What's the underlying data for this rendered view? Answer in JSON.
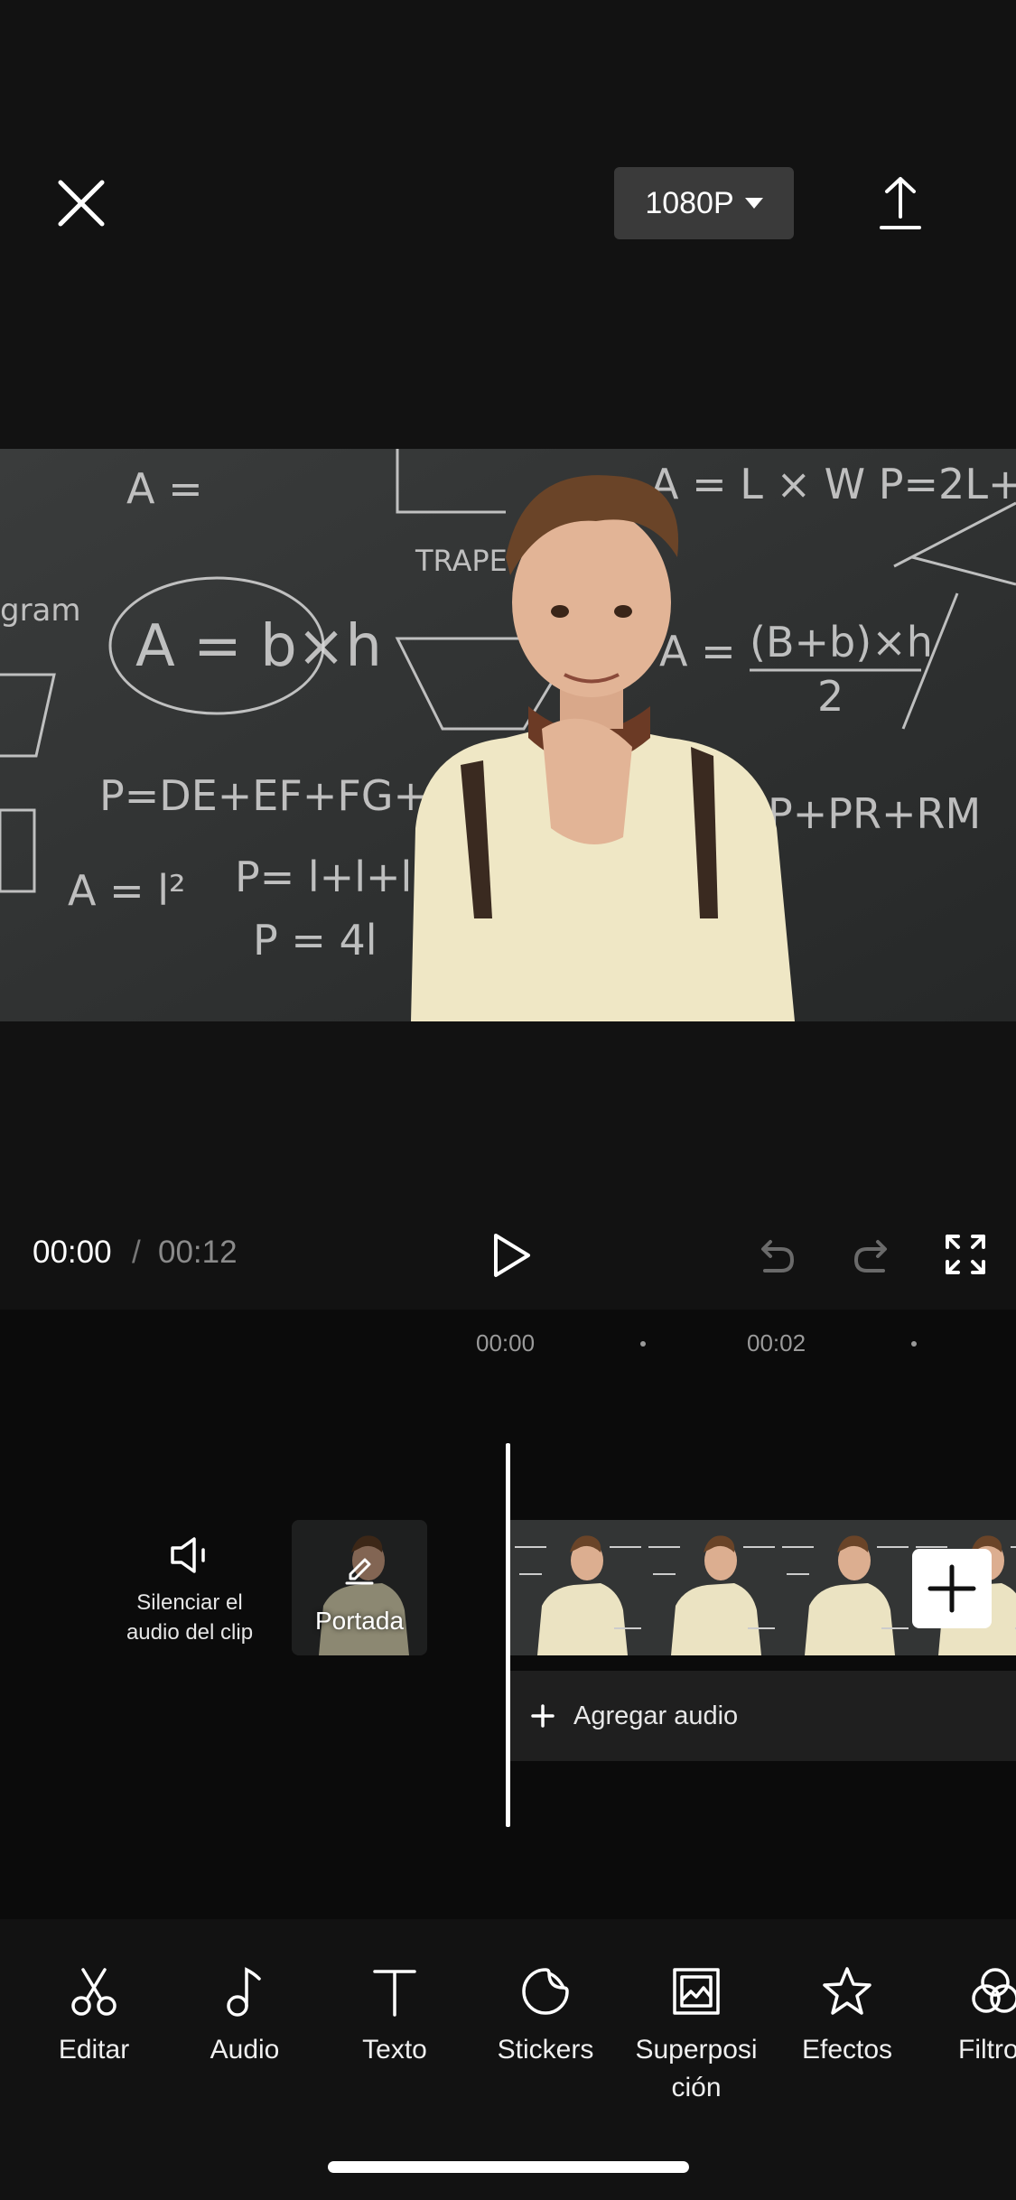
{
  "header": {
    "resolution": "1080P",
    "close_icon": "close-icon",
    "export_icon": "upload-icon"
  },
  "playback": {
    "current_time": "00:00",
    "separator": "/",
    "total_time": "00:12"
  },
  "timeline": {
    "ruler": [
      "00:00",
      "00:02"
    ],
    "mute_label_line1": "Silenciar el",
    "mute_label_line2": "audio del clip",
    "cover_label": "Portada",
    "add_audio_label": "Agregar audio"
  },
  "toolbar": {
    "items": [
      {
        "label": "Editar",
        "icon": "scissors-icon"
      },
      {
        "label": "Audio",
        "icon": "music-note-icon"
      },
      {
        "label": "Texto",
        "icon": "text-icon"
      },
      {
        "label": "Stickers",
        "icon": "sticker-icon"
      },
      {
        "label": "Superposi\nción",
        "icon": "overlay-icon"
      },
      {
        "label": "Efectos",
        "icon": "star-icon"
      },
      {
        "label": "Filtro",
        "icon": "filter-icon"
      }
    ]
  },
  "colors": {
    "background": "#121212",
    "timeline_bg": "#0b0b0b",
    "resolution_bg": "#3a3a3a"
  }
}
